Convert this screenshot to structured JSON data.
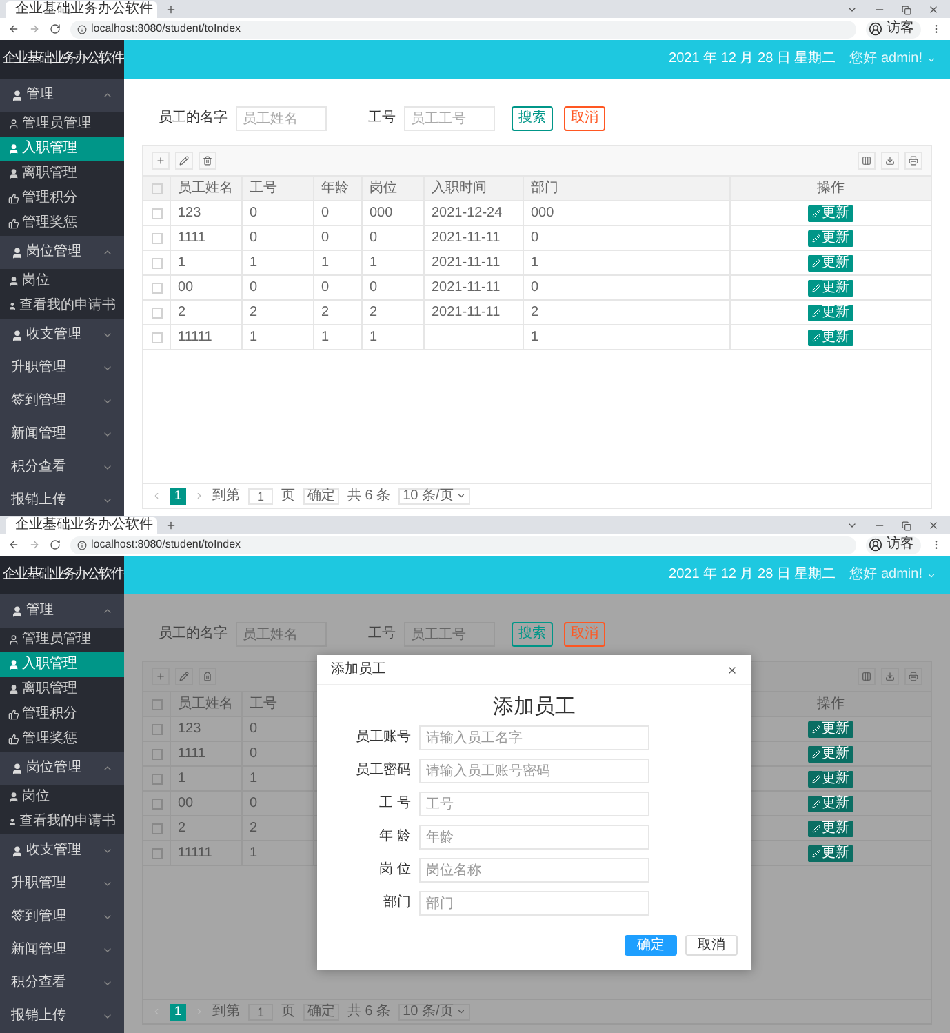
{
  "screens": [
    {
      "browser": {
        "tab_title": "企业基础业务办公软件",
        "url": "localhost:8080/student/toIndex",
        "profile": "访客"
      },
      "app_title": "企业基础业务办公软件",
      "header": {
        "date": "2021 年 12 月 28 日 星期二",
        "greeting": "您好 admin!"
      },
      "sidebar": [
        {
          "label": "管理",
          "kind": "user",
          "expanded": true,
          "children": [
            {
              "label": "管理员管理",
              "kind": "user-outline",
              "selected": false
            },
            {
              "label": "入职管理",
              "kind": "user",
              "selected": true
            },
            {
              "label": "离职管理",
              "kind": "user",
              "selected": false
            },
            {
              "label": "管理积分",
              "kind": "like",
              "selected": false
            },
            {
              "label": "管理奖惩",
              "kind": "like",
              "selected": false
            }
          ]
        },
        {
          "label": "岗位管理",
          "kind": "user",
          "expanded": true,
          "children": [
            {
              "label": "岗位",
              "kind": "user",
              "selected": false
            },
            {
              "label": "查看我的申请书",
              "kind": "user",
              "selected": false
            }
          ]
        },
        {
          "label": "收支管理",
          "kind": "user",
          "expanded": false
        },
        {
          "label": "升职管理",
          "kind": "plain",
          "expanded": false
        },
        {
          "label": "签到管理",
          "kind": "plain",
          "expanded": false
        },
        {
          "label": "新闻管理",
          "kind": "plain",
          "expanded": false
        },
        {
          "label": "积分查看",
          "kind": "plain",
          "expanded": false
        },
        {
          "label": "报销上传",
          "kind": "plain",
          "expanded": false
        }
      ],
      "search": {
        "fields": [
          {
            "label": "员工的名字",
            "placeholder": "员工姓名"
          },
          {
            "label": "工号",
            "placeholder": "员工工号"
          }
        ],
        "buttons": [
          {
            "label": "搜索",
            "kind": "primary"
          },
          {
            "label": "取消",
            "kind": "danger"
          }
        ]
      },
      "table": {
        "all_checked": false,
        "columns": [
          "员工姓名",
          "工号",
          "年龄",
          "岗位",
          "入职时间",
          "部门"
        ],
        "action_column": "操作",
        "rows": [
          {
            "checked": false,
            "cells": [
              "123",
              "0",
              "0",
              "000",
              "2021-12-24",
              "000"
            ],
            "action": "更新"
          },
          {
            "checked": false,
            "cells": [
              "1111",
              "0",
              "0",
              "0",
              "2021-11-11",
              "0"
            ],
            "action": "更新"
          },
          {
            "checked": false,
            "cells": [
              "1",
              "1",
              "1",
              "1",
              "2021-11-11",
              "1"
            ],
            "action": "更新"
          },
          {
            "checked": false,
            "cells": [
              "00",
              "0",
              "0",
              "0",
              "2021-11-11",
              "0"
            ],
            "action": "更新"
          },
          {
            "checked": false,
            "cells": [
              "2",
              "2",
              "2",
              "2",
              "2021-11-11",
              "2"
            ],
            "action": "更新"
          },
          {
            "checked": false,
            "cells": [
              "11111",
              "1",
              "1",
              "1",
              "",
              "1"
            ],
            "action": "更新"
          }
        ]
      },
      "pagination": {
        "page": "1",
        "goto_label": "到第",
        "goto_value": "1",
        "page_unit": "页",
        "confirm": "确定",
        "total": "共 6 条",
        "page_size": "10 条/页"
      }
    },
    {
      "browser": {
        "tab_title": "企业基础业务办公软件",
        "url": "localhost:8080/student/toIndex",
        "profile": "访客"
      },
      "app_title": "企业基础业务办公软件",
      "header": {
        "date": "2021 年 12 月 28 日 星期二",
        "greeting": "您好 admin!"
      },
      "sidebar": [
        {
          "label": "管理",
          "kind": "user",
          "expanded": true,
          "children": [
            {
              "label": "管理员管理",
              "kind": "user-outline",
              "selected": false
            },
            {
              "label": "入职管理",
              "kind": "user",
              "selected": true
            },
            {
              "label": "离职管理",
              "kind": "user",
              "selected": false
            },
            {
              "label": "管理积分",
              "kind": "like",
              "selected": false
            },
            {
              "label": "管理奖惩",
              "kind": "like",
              "selected": false
            }
          ]
        },
        {
          "label": "岗位管理",
          "kind": "user",
          "expanded": true,
          "children": [
            {
              "label": "岗位",
              "kind": "user",
              "selected": false
            },
            {
              "label": "查看我的申请书",
              "kind": "user",
              "selected": false
            }
          ]
        },
        {
          "label": "收支管理",
          "kind": "user",
          "expanded": false
        },
        {
          "label": "升职管理",
          "kind": "plain",
          "expanded": false
        },
        {
          "label": "签到管理",
          "kind": "plain",
          "expanded": false
        },
        {
          "label": "新闻管理",
          "kind": "plain",
          "expanded": false
        },
        {
          "label": "积分查看",
          "kind": "plain",
          "expanded": false
        },
        {
          "label": "报销上传",
          "kind": "plain",
          "expanded": false
        }
      ],
      "search": {
        "fields": [
          {
            "label": "员工的名字",
            "placeholder": "员工姓名"
          },
          {
            "label": "工号",
            "placeholder": "员工工号"
          }
        ],
        "buttons": [
          {
            "label": "搜索",
            "kind": "primary"
          },
          {
            "label": "取消",
            "kind": "danger"
          }
        ]
      },
      "table": {
        "all_checked": false,
        "columns": [
          "员工姓名",
          "工号"
        ],
        "action_column": "操作",
        "rows": [
          {
            "checked": false,
            "cells": [
              "123",
              "0"
            ],
            "action": "更新"
          },
          {
            "checked": false,
            "cells": [
              "1111",
              "0"
            ],
            "action": "更新"
          },
          {
            "checked": false,
            "cells": [
              "1",
              "1"
            ],
            "action": "更新"
          },
          {
            "checked": false,
            "cells": [
              "00",
              "0"
            ],
            "action": "更新"
          },
          {
            "checked": false,
            "cells": [
              "2",
              "2"
            ],
            "action": "更新"
          },
          {
            "checked": false,
            "cells": [
              "11111",
              "1"
            ],
            "action": "更新"
          }
        ]
      },
      "pagination": {
        "page": "1",
        "goto_label": "到第",
        "goto_value": "1",
        "page_unit": "页",
        "confirm": "确定",
        "total": "共 6 条",
        "page_size": "10 条/页"
      },
      "dialog": {
        "title": "添加员工",
        "heading": "添加员工",
        "fields": [
          {
            "label": "员工账号",
            "placeholder": "请输入员工名字"
          },
          {
            "label": "员工密码",
            "placeholder": "请输入员工账号密码"
          },
          {
            "label": "工 号",
            "placeholder": "工号"
          },
          {
            "label": "年 龄",
            "placeholder": "年龄"
          },
          {
            "label": "岗 位",
            "placeholder": "岗位名称"
          },
          {
            "label": "部门",
            "placeholder": "部门"
          }
        ],
        "buttons": [
          {
            "label": "确定",
            "kind": "primary"
          },
          {
            "label": "取消",
            "kind": "plain"
          }
        ]
      }
    }
  ]
}
